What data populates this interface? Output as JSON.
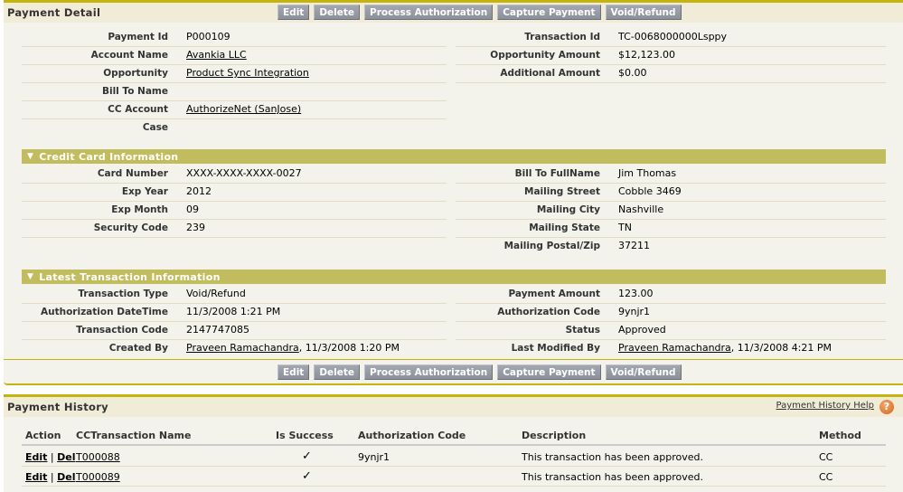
{
  "detail": {
    "title": "Payment Detail",
    "buttons": [
      "Edit",
      "Delete",
      "Process Authorization",
      "Capture Payment",
      "Void/Refund"
    ],
    "left_fields": [
      {
        "label": "Payment Id",
        "value": "P000109",
        "link": false
      },
      {
        "label": "Account Name",
        "value": "Avankia LLC",
        "link": true
      },
      {
        "label": "Opportunity",
        "value": "Product Sync Integration",
        "link": true
      },
      {
        "label": "Bill To Name",
        "value": "",
        "link": false
      },
      {
        "label": "CC Account",
        "value": "AuthorizeNet (SanJose)",
        "link": true
      },
      {
        "label": "Case",
        "value": "",
        "link": false
      }
    ],
    "right_fields": [
      {
        "label": "Transaction Id",
        "value": "TC-0068000000Lsppy"
      },
      {
        "label": "Opportunity Amount",
        "value": "$12,123.00"
      },
      {
        "label": "Additional Amount",
        "value": "$0.00"
      }
    ]
  },
  "credit_card": {
    "title": "Credit Card Information",
    "left_fields": [
      {
        "label": "Card Number",
        "value": "XXXX-XXXX-XXXX-0027"
      },
      {
        "label": "Exp Year",
        "value": "2012"
      },
      {
        "label": "Exp Month",
        "value": "09"
      },
      {
        "label": "Security Code",
        "value": "239"
      }
    ],
    "right_fields": [
      {
        "label": "Bill To FullName",
        "value": "Jim Thomas"
      },
      {
        "label": "Mailing Street",
        "value": "Cobble 3469"
      },
      {
        "label": "Mailing City",
        "value": "Nashville"
      },
      {
        "label": "Mailing State",
        "value": "TN"
      },
      {
        "label": "Mailing Postal/Zip",
        "value": "37211"
      }
    ]
  },
  "transaction": {
    "title": "Latest Transaction Information",
    "left_fields": [
      {
        "label": "Transaction Type",
        "value": "Void/Refund"
      },
      {
        "label": "Authorization DateTime",
        "value": "11/3/2008 1:21 PM"
      },
      {
        "label": "Transaction Code",
        "value": "2147747085"
      },
      {
        "label": "Created By",
        "link": "Praveen Ramachandra",
        "value": ", 11/3/2008 1:20 PM"
      }
    ],
    "right_fields": [
      {
        "label": "Payment Amount",
        "value": "123.00"
      },
      {
        "label": "Authorization Code",
        "value": "9ynjr1"
      },
      {
        "label": "Status",
        "value": "Approved"
      },
      {
        "label": "Last Modified By",
        "link": "Praveen Ramachandra",
        "value": ", 11/3/2008 4:21 PM"
      }
    ]
  },
  "history": {
    "title": "Payment History",
    "help_label": "Payment History Help",
    "help_icon": "question-icon",
    "columns": [
      "Action",
      "CCTransaction Name",
      "Is Success",
      "Authorization Code",
      "Description",
      "Method"
    ],
    "edit_label": "Edit",
    "sep": "|",
    "del_label": "Del",
    "rows": [
      {
        "name": "T000088",
        "success": "✓",
        "auth_code": "9ynjr1",
        "description": "This transaction has been approved.",
        "method": "CC"
      },
      {
        "name": "T000089",
        "success": "✓",
        "auth_code": "",
        "description": "This transaction has been approved.",
        "method": "CC"
      }
    ]
  }
}
